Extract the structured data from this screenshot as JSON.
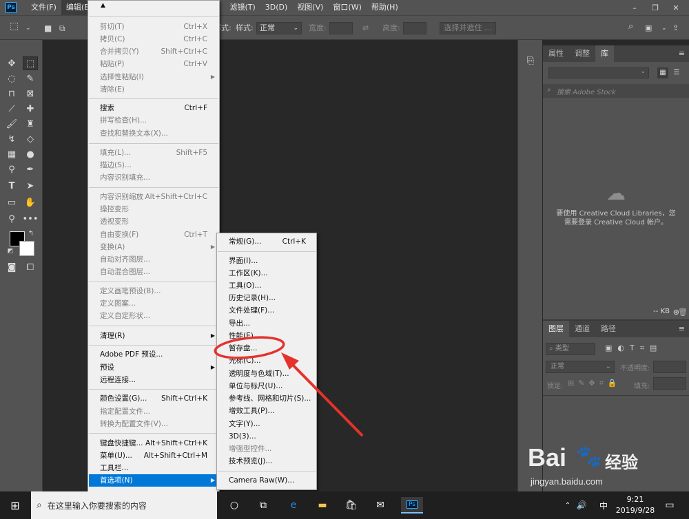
{
  "app": {
    "logo": "Ps"
  },
  "menubar": [
    {
      "label": "文件(F)"
    },
    {
      "label": "编辑(E)"
    },
    {
      "label": "图像(I)"
    },
    {
      "label": "图层(L)"
    },
    {
      "label": "文字(Y)"
    },
    {
      "label": "选择(S)"
    },
    {
      "label": "滤镜(T)"
    },
    {
      "label": "3D(D)"
    },
    {
      "label": "视图(V)"
    },
    {
      "label": "窗口(W)"
    },
    {
      "label": "帮助(H)"
    }
  ],
  "window_controls": {
    "minimize": "–",
    "restore": "❐",
    "close": "✕"
  },
  "options": {
    "style_label": "样式:",
    "style_value": "正常",
    "width_label": "宽度:",
    "height_label": "高度:",
    "select_mask": "选择并遮住 ..."
  },
  "edit_menu": {
    "top_arrow": "▲",
    "bottom_arrow": "▼",
    "items": [
      {
        "label": "剪切(T)",
        "shortcut": "Ctrl+X",
        "disabled": true
      },
      {
        "label": "拷贝(C)",
        "shortcut": "Ctrl+C",
        "disabled": true
      },
      {
        "label": "合并拷贝(Y)",
        "shortcut": "Shift+Ctrl+C",
        "disabled": true
      },
      {
        "label": "粘贴(P)",
        "shortcut": "Ctrl+V",
        "disabled": true
      },
      {
        "label": "选择性粘贴(I)",
        "shortcut": "",
        "disabled": true,
        "submenu": true
      },
      {
        "label": "清除(E)",
        "shortcut": "",
        "disabled": true
      },
      {
        "label": "搜索",
        "shortcut": "Ctrl+F",
        "disabled": false
      },
      {
        "label": "拼写检查(H)...",
        "shortcut": "",
        "disabled": true
      },
      {
        "label": "查找和替换文本(X)...",
        "shortcut": "",
        "disabled": true
      },
      {
        "label": "填充(L)...",
        "shortcut": "Shift+F5",
        "disabled": true
      },
      {
        "label": "描边(S)...",
        "shortcut": "",
        "disabled": true
      },
      {
        "label": "内容识别填充...",
        "shortcut": "",
        "disabled": true
      },
      {
        "label": "内容识别缩放",
        "shortcut": "Alt+Shift+Ctrl+C",
        "disabled": true
      },
      {
        "label": "操控变形",
        "shortcut": "",
        "disabled": true
      },
      {
        "label": "透视变形",
        "shortcut": "",
        "disabled": true
      },
      {
        "label": "自由变换(F)",
        "shortcut": "Ctrl+T",
        "disabled": true
      },
      {
        "label": "变换(A)",
        "shortcut": "",
        "disabled": true,
        "submenu": true
      },
      {
        "label": "自动对齐图层...",
        "shortcut": "",
        "disabled": true
      },
      {
        "label": "自动混合图层...",
        "shortcut": "",
        "disabled": true
      },
      {
        "label": "定义画笔预设(B)...",
        "shortcut": "",
        "disabled": true
      },
      {
        "label": "定义图案...",
        "shortcut": "",
        "disabled": true
      },
      {
        "label": "定义自定形状...",
        "shortcut": "",
        "disabled": true
      },
      {
        "label": "清理(R)",
        "shortcut": "",
        "disabled": false,
        "submenu": true
      },
      {
        "label": "Adobe PDF 预设...",
        "shortcut": "",
        "disabled": false
      },
      {
        "label": "预设",
        "shortcut": "",
        "disabled": false,
        "submenu": true
      },
      {
        "label": "远程连接...",
        "shortcut": "",
        "disabled": false
      },
      {
        "label": "颜色设置(G)...",
        "shortcut": "Shift+Ctrl+K",
        "disabled": false
      },
      {
        "label": "指定配置文件...",
        "shortcut": "",
        "disabled": true
      },
      {
        "label": "转换为配置文件(V)...",
        "shortcut": "",
        "disabled": true
      },
      {
        "label": "键盘快捷键...",
        "shortcut": "Alt+Shift+Ctrl+K",
        "disabled": false
      },
      {
        "label": "菜单(U)...",
        "shortcut": "Alt+Shift+Ctrl+M",
        "disabled": false
      },
      {
        "label": "工具栏...",
        "shortcut": "",
        "disabled": false
      },
      {
        "label": "首选项(N)",
        "shortcut": "",
        "disabled": false,
        "submenu": true,
        "highlighted": true
      }
    ]
  },
  "prefs_menu": {
    "items": [
      {
        "label": "常规(G)...",
        "shortcut": "Ctrl+K"
      },
      {
        "label": "界面(I)...",
        "shortcut": ""
      },
      {
        "label": "工作区(K)...",
        "shortcut": ""
      },
      {
        "label": "工具(O)...",
        "shortcut": ""
      },
      {
        "label": "历史记录(H)...",
        "shortcut": ""
      },
      {
        "label": "文件处理(F)...",
        "shortcut": ""
      },
      {
        "label": "导出...",
        "shortcut": ""
      },
      {
        "label": "性能(E)...",
        "shortcut": ""
      },
      {
        "label": "暂存盘...",
        "shortcut": ""
      },
      {
        "label": "光标(C)...",
        "shortcut": ""
      },
      {
        "label": "透明度与色域(T)...",
        "shortcut": ""
      },
      {
        "label": "单位与标尺(U)...",
        "shortcut": ""
      },
      {
        "label": "参考线、网格和切片(S)...",
        "shortcut": ""
      },
      {
        "label": "增效工具(P)...",
        "shortcut": ""
      },
      {
        "label": "文字(Y)...",
        "shortcut": ""
      },
      {
        "label": "3D(3)...",
        "shortcut": ""
      },
      {
        "label": "增强型控件...",
        "shortcut": "",
        "disabled": true
      },
      {
        "label": "技术预览(J)...",
        "shortcut": ""
      },
      {
        "label": "Camera Raw(W)...",
        "shortcut": ""
      }
    ]
  },
  "panel_top": {
    "tabs": [
      "属性",
      "调整",
      "库"
    ],
    "search_placeholder": "搜索 Adobe Stock",
    "message_line1": "要使用 Creative Cloud Libraries，您",
    "message_line2": "需要登录 Creative Cloud 帐户。",
    "footer_kb": "-- KB"
  },
  "panel_bot": {
    "tabs": [
      "图层",
      "通道",
      "路径"
    ],
    "filter_placeholder": "类型",
    "blend_mode": "正常",
    "opacity_label": "不透明度:",
    "lock_label": "锁定:",
    "fill_label": "填充:"
  },
  "taskbar": {
    "search_text": "在这里输入你要搜索的内容",
    "time": "9:21",
    "date": "2019/9/28",
    "ime": "中"
  },
  "watermark": {
    "brand": "Bai",
    "brand_suffix": "经验",
    "url": "jingyan.baidu.com"
  },
  "colors": {
    "highlight": "#0078d7",
    "annotation": "#e5322d",
    "ps_blue": "#31a8ff"
  }
}
